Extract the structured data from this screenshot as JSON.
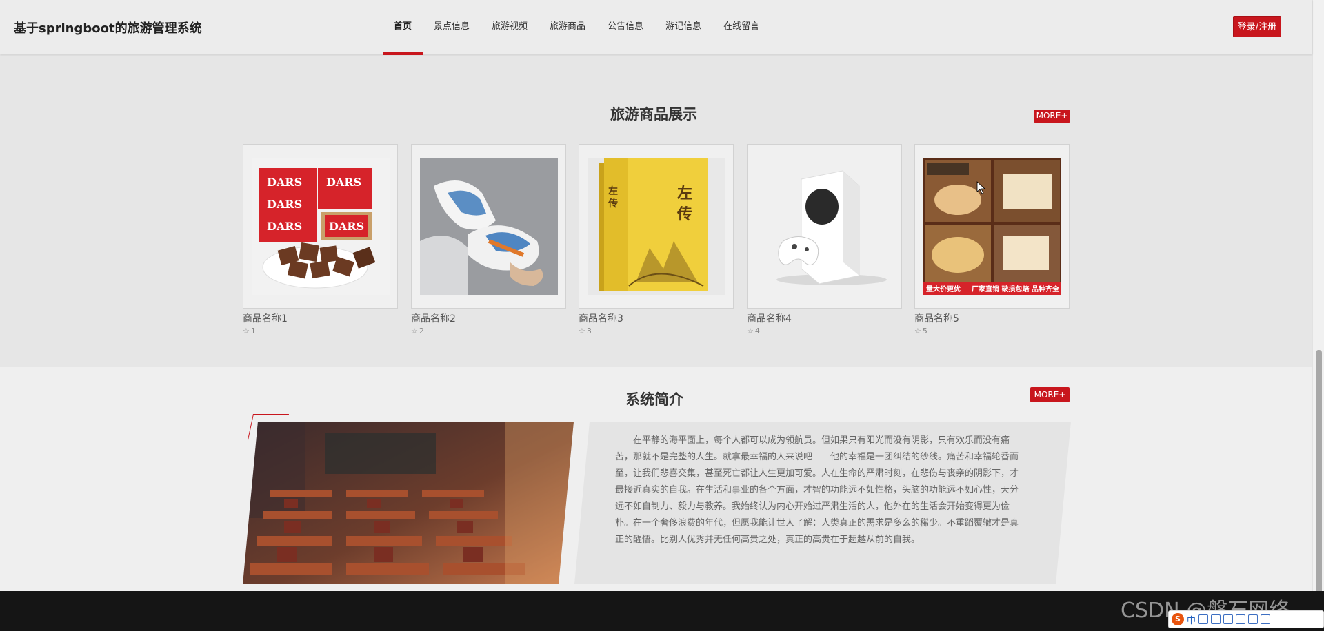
{
  "header": {
    "site_title": "基于springboot的旅游管理系统",
    "nav": [
      {
        "label": "首页",
        "active": true
      },
      {
        "label": "景点信息",
        "active": false
      },
      {
        "label": "旅游视频",
        "active": false
      },
      {
        "label": "旅游商品",
        "active": false
      },
      {
        "label": "公告信息",
        "active": false
      },
      {
        "label": "游记信息",
        "active": false
      },
      {
        "label": "在线留言",
        "active": false
      }
    ],
    "login_label": "登录/注册"
  },
  "products": {
    "title": "旅游商品展示",
    "more_label": "MORE+",
    "items": [
      {
        "name": "商品名称1",
        "count": "1",
        "image": "chocolate-image"
      },
      {
        "name": "商品名称2",
        "count": "2",
        "image": "sneakers-image"
      },
      {
        "name": "商品名称3",
        "count": "3",
        "image": "book-image"
      },
      {
        "name": "商品名称4",
        "count": "4",
        "image": "game-console-image"
      },
      {
        "name": "商品名称5",
        "count": "5",
        "image": "pastries-image"
      }
    ],
    "star_icon": "star-outline-icon"
  },
  "intro": {
    "title": "系统简介",
    "more_label": "MORE+",
    "text": "在平静的海平面上，每个人都可以成为领航员。但如果只有阳光而没有阴影，只有欢乐而没有痛苦，那就不是完整的人生。就拿最幸福的人来说吧——他的幸福是一团纠结的纱线。痛苦和幸福轮番而至，让我们悲喜交集，甚至死亡都让人生更加可爱。人在生命的严肃时刻，在悲伤与丧亲的阴影下，才最接近真实的自我。在生活和事业的各个方面，才智的功能远不如性格，头脑的功能远不如心性，天分远不如自制力、毅力与教养。我始终认为内心开始过严肃生活的人，他外在的生活会开始变得更为俭朴。在一个奢侈浪费的年代，但愿我能让世人了解：人类真正的需求是多么的稀少。不重蹈覆辙才是真正的醒悟。比别人优秀并无任何高贵之处，真正的高贵在于超越从前的自我。",
    "image": "classroom-image"
  },
  "overlay": {
    "watermark": "CSDN @磐石网络",
    "ime_label": "中",
    "ime_logo": "S"
  },
  "colors": {
    "accent": "#c8161d",
    "background": "#ececec",
    "footer": "#151515"
  }
}
